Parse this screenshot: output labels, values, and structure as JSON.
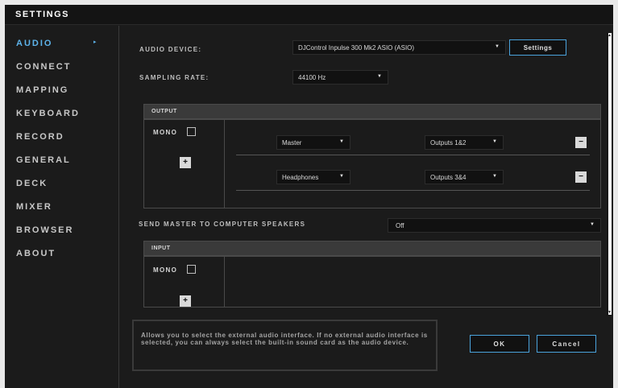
{
  "window": {
    "title": "SETTINGS"
  },
  "sidebar": {
    "items": [
      {
        "label": "AUDIO",
        "active": true
      },
      {
        "label": "CONNECT"
      },
      {
        "label": "MAPPING"
      },
      {
        "label": "KEYBOARD"
      },
      {
        "label": "RECORD"
      },
      {
        "label": "GENERAL"
      },
      {
        "label": "DECK"
      },
      {
        "label": "MIXER"
      },
      {
        "label": "BROWSER"
      },
      {
        "label": "ABOUT"
      }
    ],
    "active_indicator": "▸"
  },
  "audio": {
    "device_label": "AUDIO DEVICE:",
    "device_value": "DJControl Inpulse 300 Mk2 ASIO (ASIO)",
    "settings_button": "Settings",
    "sampling_label": "SAMPLING RATE:",
    "sampling_value": "44100 Hz"
  },
  "output": {
    "header": "OUTPUT",
    "mono_label": "MONO",
    "add_button": "+",
    "rows": [
      {
        "channel": "Master",
        "outputs": "Outputs 1&2",
        "remove": "−"
      },
      {
        "channel": "Headphones",
        "outputs": "Outputs 3&4",
        "remove": "−"
      }
    ]
  },
  "send_master": {
    "label": "SEND MASTER TO COMPUTER SPEAKERS",
    "value": "Off"
  },
  "input": {
    "header": "INPUT",
    "mono_label": "MONO",
    "add_button": "+"
  },
  "footer": {
    "hint": "Allows you to select the external audio interface. If no external audio interface is selected, you can always select the built-in sound card as the audio device.",
    "ok_label": "OK",
    "cancel_label": "Cancel"
  },
  "icons": {
    "dropdown": "▼",
    "scroll_up": "▲",
    "scroll_down": "▼"
  },
  "colors": {
    "accent": "#5db3ea",
    "button_border": "#4aa3dc",
    "background": "#1b1b1b",
    "section_header": "#3a3a3a"
  }
}
